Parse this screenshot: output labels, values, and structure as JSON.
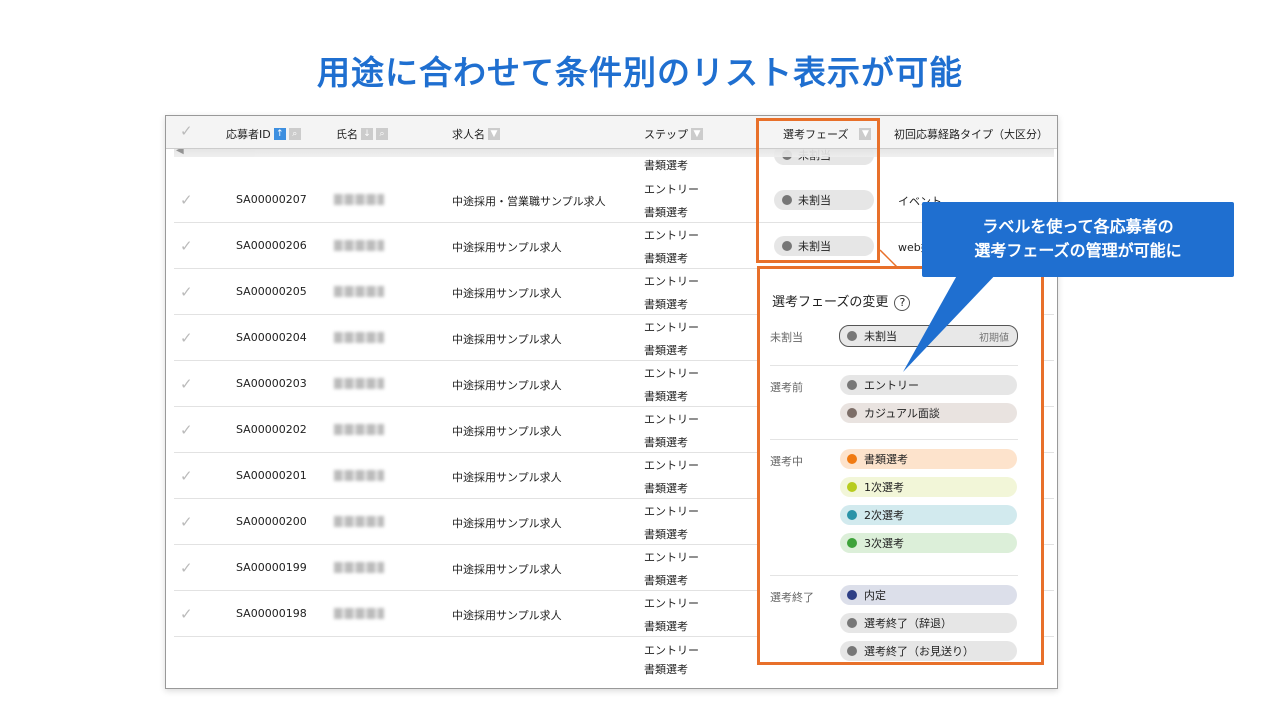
{
  "title": "用途に合わせて条件別のリスト表示が可能",
  "headers": {
    "id": "応募者ID",
    "name": "氏名",
    "job": "求人名",
    "step": "ステップ",
    "phase": "選考フェーズ",
    "route": "初回応募経路タイプ（大区分）"
  },
  "top_partial": {
    "step2": "書類選考",
    "phase": "未割当"
  },
  "rows": [
    {
      "id": "SA00000207",
      "job": "中途採用・営業職サンプル求人",
      "s1": "エントリー",
      "s2": "書類選考",
      "phase": "未割当",
      "route": "イベント"
    },
    {
      "id": "SA00000206",
      "job": "中途採用サンプル求人",
      "s1": "エントリー",
      "s2": "書類選考",
      "phase": "未割当",
      "route": "web媒"
    },
    {
      "id": "SA00000205",
      "job": "中途採用サンプル求人",
      "s1": "エントリー",
      "s2": "書類選考"
    },
    {
      "id": "SA00000204",
      "job": "中途採用サンプル求人",
      "s1": "エントリー",
      "s2": "書類選考"
    },
    {
      "id": "SA00000203",
      "job": "中途採用サンプル求人",
      "s1": "エントリー",
      "s2": "書類選考"
    },
    {
      "id": "SA00000202",
      "job": "中途採用サンプル求人",
      "s1": "エントリー",
      "s2": "書類選考"
    },
    {
      "id": "SA00000201",
      "job": "中途採用サンプル求人",
      "s1": "エントリー",
      "s2": "書類選考"
    },
    {
      "id": "SA00000200",
      "job": "中途採用サンプル求人",
      "s1": "エントリー",
      "s2": "書類選考"
    },
    {
      "id": "SA00000199",
      "job": "中途採用サンプル求人",
      "s1": "エントリー",
      "s2": "書類選考"
    },
    {
      "id": "SA00000198",
      "job": "中途採用サンプル求人",
      "s1": "エントリー",
      "s2": "書類選考"
    }
  ],
  "bottom_partial": {
    "s1": "エントリー",
    "s2": "書類選考"
  },
  "panel": {
    "title": "選考フェーズの変更",
    "help": "?",
    "groups": [
      {
        "label": "未割当",
        "options": [
          {
            "label": "未割当",
            "note": "初期値",
            "dot": "#777777",
            "bg": "#e8e8e8",
            "selected": true
          }
        ]
      },
      {
        "label": "選考前",
        "options": [
          {
            "label": "エントリー",
            "dot": "#777777",
            "bg": "#e6e6e6"
          },
          {
            "label": "カジュアル面談",
            "dot": "#7d6e68",
            "bg": "#e9e3e0"
          }
        ]
      },
      {
        "label": "選考中",
        "options": [
          {
            "label": "書類選考",
            "dot": "#f07a12",
            "bg": "#fde3cc"
          },
          {
            "label": "1次選考",
            "dot": "#b7cc1e",
            "bg": "#f2f6d8"
          },
          {
            "label": "2次選考",
            "dot": "#2a93a8",
            "bg": "#d2eaee"
          },
          {
            "label": "3次選考",
            "dot": "#3ea23a",
            "bg": "#dcefd9"
          }
        ]
      },
      {
        "label": "選考終了",
        "options": [
          {
            "label": "内定",
            "dot": "#2e3f86",
            "bg": "#dcdfea"
          },
          {
            "label": "選考終了（辞退）",
            "dot": "#777777",
            "bg": "#e6e6e6"
          },
          {
            "label": "選考終了（お見送り）",
            "dot": "#777777",
            "bg": "#e6e6e6"
          }
        ]
      }
    ]
  },
  "callout": {
    "line1": "ラベルを使って各応募者の",
    "line2": "選考フェーズの管理が可能に"
  },
  "colors": {
    "accent": "#1f6fd0",
    "highlight": "#e8702a"
  }
}
